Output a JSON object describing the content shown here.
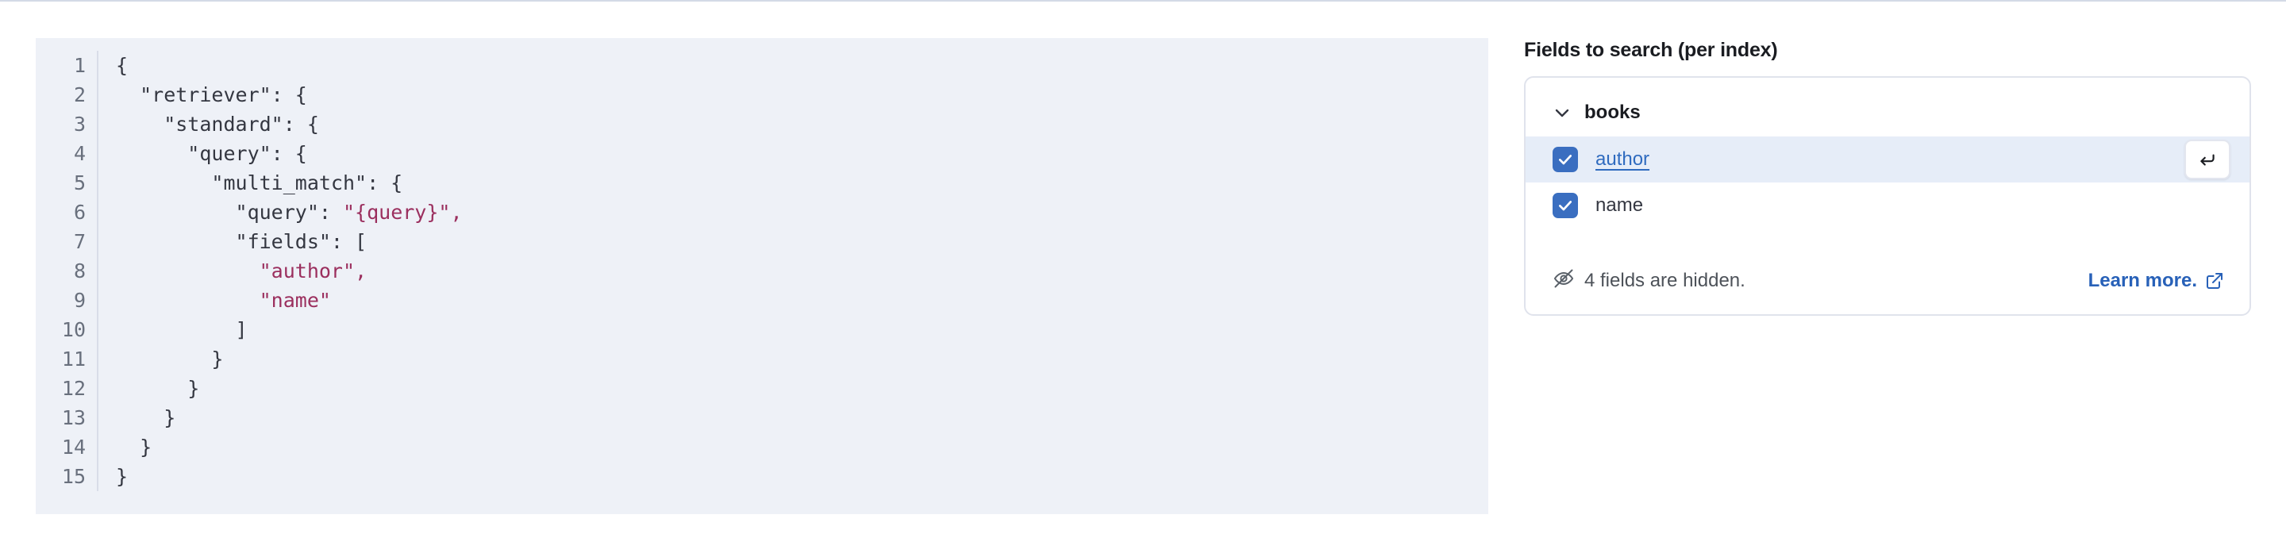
{
  "code_editor": {
    "language": "json",
    "line_numbers": [
      "1",
      "2",
      "3",
      "4",
      "5",
      "6",
      "7",
      "8",
      "9",
      "10",
      "11",
      "12",
      "13",
      "14",
      "15"
    ],
    "lines": [
      "{",
      "  \"retriever\": {",
      "    \"standard\": {",
      "      \"query\": {",
      "        \"multi_match\": {",
      "          \"query\": ",
      "          \"fields\": [",
      "            ",
      "            ",
      "          ]",
      "        }",
      "      }",
      "    }",
      "  }",
      "}"
    ],
    "string_tokens": {
      "line6_value": "\"{query}\",",
      "line8_value": "\"author\",",
      "line9_value": "\"name\""
    },
    "colors": {
      "background": "#eef1f7",
      "text": "#343741",
      "gutter_text": "#69707d",
      "string": "#9b2f5e"
    }
  },
  "fields_panel": {
    "title": "Fields to search (per index)",
    "index_group": {
      "name": "books",
      "expanded": true,
      "chevron_icon": "chevron-down-icon",
      "fields": [
        {
          "label": "author",
          "checked": true,
          "selected": true,
          "is_link": true,
          "action_icon": "enter-key-icon"
        },
        {
          "label": "name",
          "checked": false,
          "selected": false,
          "is_link": false,
          "action_icon": ""
        }
      ]
    },
    "hidden_notice": {
      "icon": "eye-off-icon",
      "text": "4 fields are hidden.",
      "hidden_count": 4
    },
    "learn_more": {
      "label": "Learn more.",
      "icon": "external-link-icon"
    },
    "colors": {
      "accent": "#3a6ec0",
      "link": "#2f6bbf",
      "selected_row": "#e6edf8",
      "card_border": "#e0e3ec"
    }
  }
}
